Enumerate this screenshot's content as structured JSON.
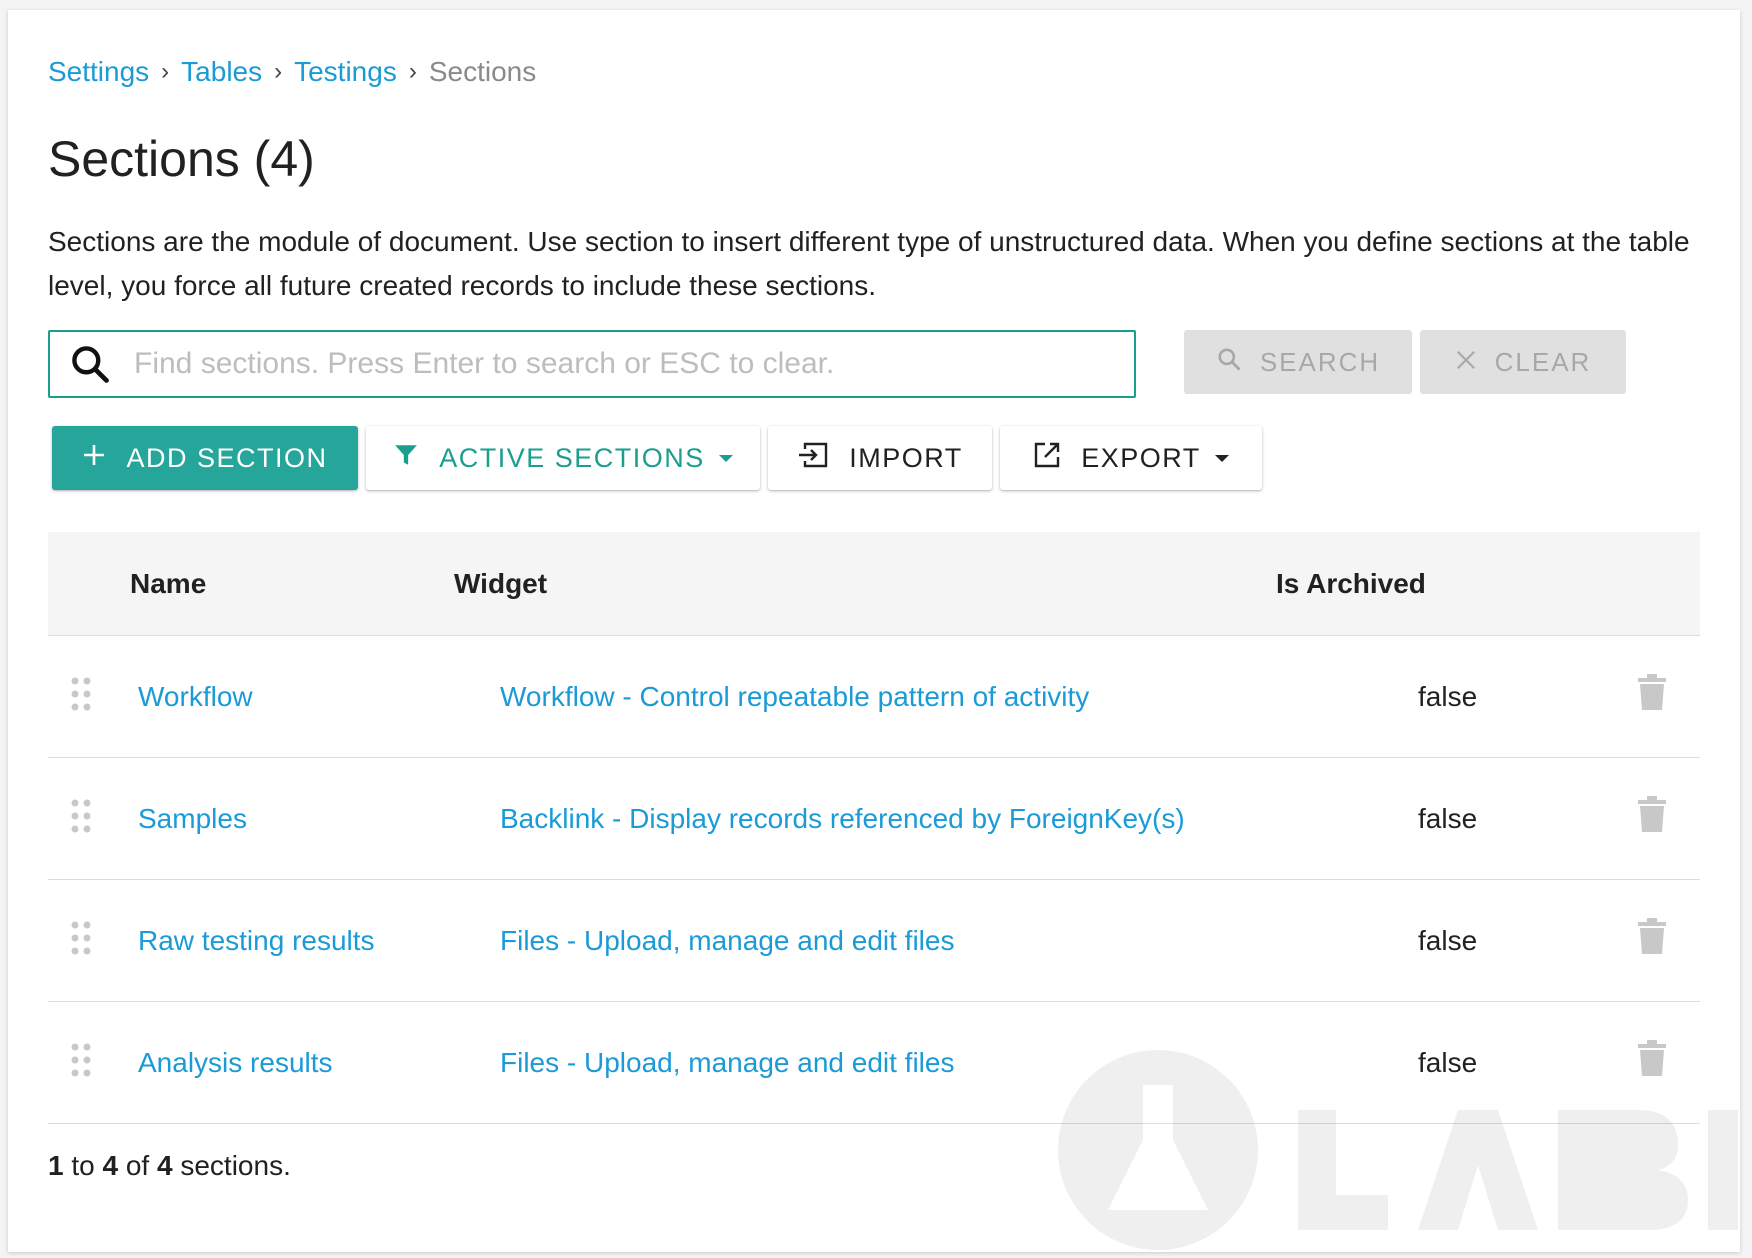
{
  "breadcrumb": {
    "items": [
      "Settings",
      "Tables",
      "Testings"
    ],
    "current": "Sections",
    "separator": "›"
  },
  "page": {
    "title": "Sections (4)",
    "description": "Sections are the module of document. Use section to insert different type of unstructured data. When you define sections at the table level, you force all future created records to include these sections."
  },
  "search": {
    "placeholder": "Find sections. Press Enter to search or ESC to clear.",
    "value": "",
    "search_label": "SEARCH",
    "clear_label": "CLEAR"
  },
  "toolbar": {
    "add_label": "ADD SECTION",
    "filter_label": "ACTIVE SECTIONS",
    "import_label": "IMPORT",
    "export_label": "EXPORT"
  },
  "table": {
    "columns": [
      "Name",
      "Widget",
      "Is Archived"
    ],
    "rows": [
      {
        "name": "Workflow",
        "widget": "Workflow - Control repeatable pattern of activity",
        "archived": "false"
      },
      {
        "name": "Samples",
        "widget": "Backlink - Display records referenced by ForeignKey(s)",
        "archived": "false"
      },
      {
        "name": "Raw testing results",
        "widget": "Files - Upload, manage and edit files",
        "archived": "false"
      },
      {
        "name": "Analysis results",
        "widget": "Files - Upload, manage and edit files",
        "archived": "false"
      }
    ]
  },
  "pagination": {
    "from": "1",
    "to_word": "to",
    "to": "4",
    "of_word": "of",
    "total": "4",
    "suffix": "sections."
  },
  "colors": {
    "link": "#1a9bd7",
    "accent": "#26a69a",
    "accent_text": "#1a9e8e",
    "disabled": "#e0e0e0"
  },
  "icons": {
    "search": "search-icon",
    "clear": "close-icon",
    "add": "plus-icon",
    "filter": "filter-icon",
    "import": "import-icon",
    "export": "external-link-icon",
    "drag": "drag-handle-icon",
    "delete": "trash-icon"
  }
}
